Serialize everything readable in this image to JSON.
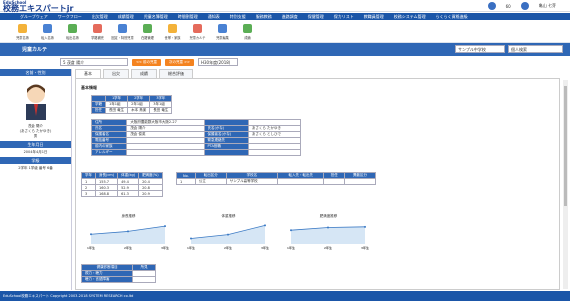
{
  "app": {
    "brand_small": "EduSchool",
    "brand": "校務エキスパートjr"
  },
  "top": {
    "notif_count": "60",
    "user": "亀山 七芽"
  },
  "nav": [
    "グループウェア",
    "ワークフロー",
    "出欠管理",
    "成績管理",
    "児童名簿管理",
    "時間割管理",
    "通知表",
    "特別支援",
    "服務教務",
    "進路調査",
    "保健管理",
    "保カリスト",
    "教職員管理",
    "校務システム管理",
    "らくらく資格進級"
  ],
  "icons": [
    "児童名簿",
    "転入名簿",
    "転出名簿",
    "学籍補完",
    "固定・特別児童",
    "在籍管理",
    "世帯・家族",
    "児童カルテ",
    "児童編集",
    "成績"
  ],
  "header": {
    "title": "児童カルテ",
    "school": "サンプル中学校",
    "filter": "個人検索"
  },
  "toolbar": {
    "student": "5 茂倉 陽介",
    "prev": "<< 前の児童",
    "next": "次の児童 >>",
    "date": "H30年度(2018)"
  },
  "left": {
    "name_label": "名前・性別",
    "name": "茂倉 陽介",
    "kana": "(あさくら たかゆき)",
    "gender": "男",
    "birth_label": "生年月日",
    "birth": "2004年4月1日",
    "class_label": "学級",
    "class": "2学年 1学級 番号 6番"
  },
  "tabs": [
    "基本",
    "出欠",
    "成績",
    "総合評価"
  ],
  "section": "基本情報",
  "grades": {
    "headers": [
      "",
      "1学年",
      "2学年",
      "3学年"
    ],
    "rows": [
      [
        "学籍",
        "1年1組",
        "2年1組",
        "3年1組"
      ],
      [
        "担任",
        "長田 竜生",
        "木本 鳥楽",
        "長田 竜生"
      ]
    ]
  },
  "info": [
    [
      "住所",
      "大阪府豊能郡大阪市大阪2-27",
      "",
      ""
    ],
    [
      "氏名",
      "茂倉 陽介",
      "氏名(かな)",
      "あさくら たかゆき"
    ],
    [
      "保護者名",
      "茂倉 俊英",
      "保護者名(かな)",
      "あさくら としひで"
    ],
    [
      "電話番号",
      "",
      "緊急連絡先",
      ""
    ],
    [
      "前内の家族",
      "",
      "PTA役職",
      ""
    ],
    [
      "アレルギー",
      "",
      "",
      ""
    ]
  ],
  "measure": {
    "headers": [
      "学年",
      "身長(cm)",
      "体重(kg)",
      "肥満度(%)"
    ],
    "rows": [
      [
        "1",
        "155.7",
        "49.4",
        "20.4"
      ],
      [
        "2",
        "160.3",
        "52.9",
        "20.8"
      ],
      [
        "3",
        "168.8",
        "61.3",
        "20.9"
      ]
    ]
  },
  "history": {
    "headers": [
      "No.",
      "転出区分",
      "学校名",
      "転入先・転出先",
      "担任",
      "異動区分"
    ],
    "rows": [
      [
        "1",
        "公立",
        "サンプル高等学校",
        "",
        "",
        ""
      ]
    ]
  },
  "charts": [
    {
      "title": "身長推移"
    },
    {
      "title": "体重推移"
    },
    {
      "title": "肥満度推移"
    }
  ],
  "chart_x": [
    "1年生",
    "2年生",
    "3年生"
  ],
  "health": {
    "headers": [
      "健康診断項目",
      "所見"
    ],
    "rows": [
      [
        "視力・聴力",
        ""
      ],
      [
        "聴力・言語障害",
        ""
      ]
    ]
  },
  "chart_data": [
    {
      "type": "area",
      "title": "身長推移",
      "categories": [
        "1年生",
        "2年生",
        "3年生"
      ],
      "values": [
        155.7,
        160.3,
        168.8
      ]
    },
    {
      "type": "area",
      "title": "体重推移",
      "categories": [
        "1年生",
        "2年生",
        "3年生"
      ],
      "values": [
        49.4,
        52.9,
        61.3
      ]
    },
    {
      "type": "area",
      "title": "肥満度推移",
      "categories": [
        "1年生",
        "2年生",
        "3年生"
      ],
      "values": [
        20.4,
        20.8,
        20.9
      ]
    }
  ],
  "footer": "EduSchool校務エキスパート Copyright 2003-2018 SYSTEM RESEARCH co.ltd"
}
